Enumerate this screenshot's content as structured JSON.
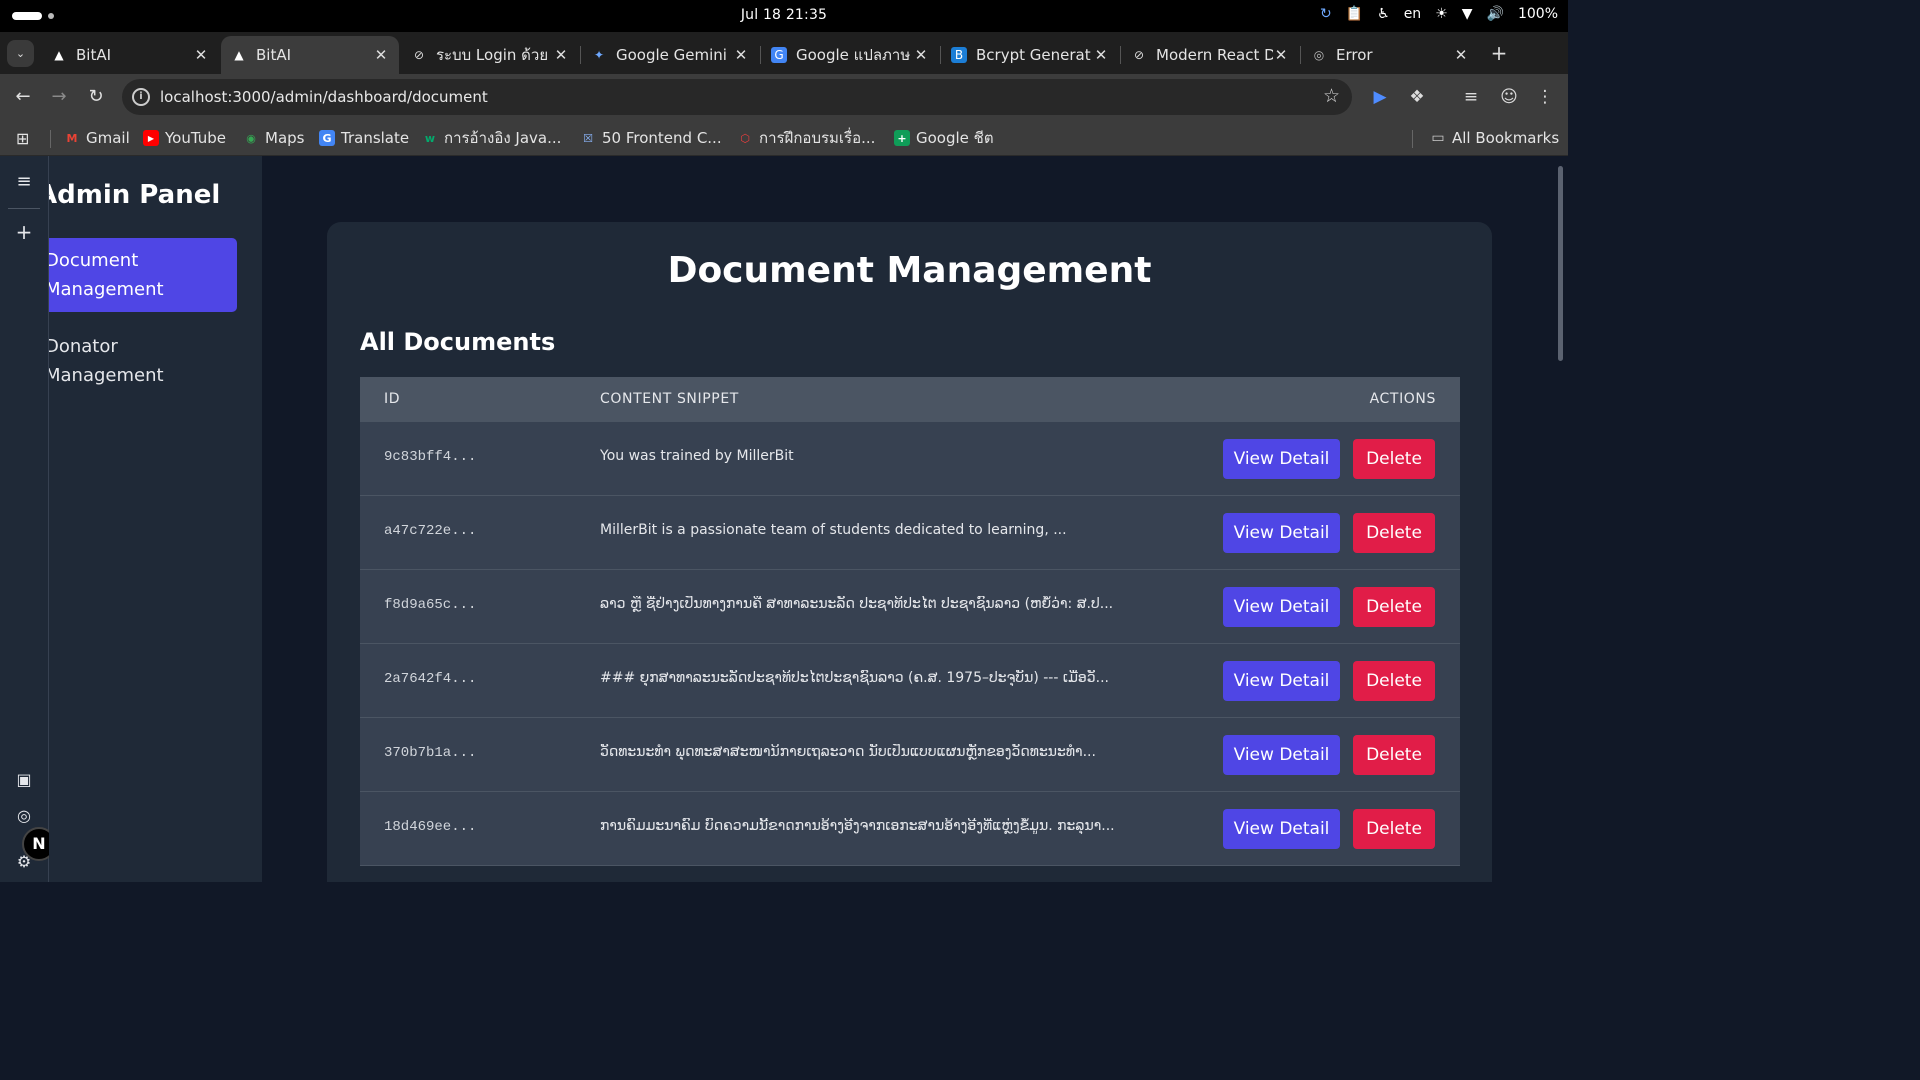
{
  "os": {
    "clock": "Jul 18  21:35",
    "language": "en",
    "battery": "100%"
  },
  "tabs": [
    {
      "title": "BitAI",
      "icon": "triangle-icon",
      "active": false
    },
    {
      "title": "BitAI",
      "icon": "triangle-icon",
      "active": true
    },
    {
      "title": "ระบบ Login ด้วย",
      "icon": "react-icon",
      "active": false
    },
    {
      "title": "Google Gemini",
      "icon": "gemini-icon",
      "active": false
    },
    {
      "title": "Google แปลภาษ",
      "icon": "translate-icon",
      "active": false
    },
    {
      "title": "Bcrypt Generat",
      "icon": "bcrypt-icon",
      "active": false
    },
    {
      "title": "Modern React D",
      "icon": "react-icon",
      "active": false
    },
    {
      "title": "Error",
      "icon": "globe-icon",
      "active": false
    }
  ],
  "address_bar": {
    "url": "localhost:3000/admin/dashboard/document"
  },
  "bookmarks": [
    {
      "label": "Gmail",
      "icon": "gmail-icon",
      "color": "#ea4335"
    },
    {
      "label": "YouTube",
      "icon": "youtube-icon",
      "color": "#ff0000"
    },
    {
      "label": "Maps",
      "icon": "maps-icon",
      "color": "#34a853"
    },
    {
      "label": "Translate",
      "icon": "translate-icon",
      "color": "#4285f4"
    },
    {
      "label": "การอ้างอิง Java...",
      "icon": "w-icon",
      "color": "#04aa6d"
    },
    {
      "label": "50 Frontend C...",
      "icon": "x-icon",
      "color": "#3b5bdb"
    },
    {
      "label": "การฝึกอบรมเรื่อ...",
      "icon": "shield-icon",
      "color": "#f03e3e"
    },
    {
      "label": "Google ชีต",
      "icon": "sheets-icon",
      "color": "#0f9d58"
    }
  ],
  "all_bookmarks_label": "All Bookmarks",
  "sidebar": {
    "title": "Admin Panel",
    "items": [
      {
        "line1": "Document",
        "line2": "Management",
        "active": true
      },
      {
        "line1": "Donator",
        "line2": "Management",
        "active": false
      }
    ]
  },
  "main": {
    "title": "Document Management",
    "section_title": "All Documents",
    "columns": {
      "id": "ID",
      "snippet": "CONTENT SNIPPET",
      "actions": "ACTIONS"
    },
    "view_label": "View Detail",
    "delete_label": "Delete",
    "rows": [
      {
        "id": "9c83bff4...",
        "snippet": "You was trained by MillerBit"
      },
      {
        "id": "a47c722e...",
        "snippet": "MillerBit is a passionate team of students dedicated to learning, ..."
      },
      {
        "id": "f8d9a65c...",
        "snippet": "ລາວ ຫຼື ຊື່ຢ່າງເປັນທາງການຄື ສາທາລະນະລັດ ປະຊາທິປະໄຕ ປະຊາຊົນລາວ (ຫຍໍ້ວ່າ: ສ.ປ..."
      },
      {
        "id": "2a7642f4...",
        "snippet": "### ຍຸກສາທາລະນະລັດປະຊາທິປະໄຕປະຊາຊົນລາວ (ຄ.ສ. 1975–ປະຈຸບັນ) --- ເມື່ອວັ..."
      },
      {
        "id": "370b7b1a...",
        "snippet": "ວັດທະນະທຳ ພຸດທະສາສະໜານິກາຍເຖລະວາດ ນັບເປັນແບບແຜນຫຼັກຂອງວັດທະນະທຳ..."
      },
      {
        "id": "18d469ee...",
        "snippet": "ການຄົມມະນາຄົມ ບົດຄວາມນີ້ຂາດການອ້າງອີງຈາກເອກະສານອ້າງອີງທີ່ແຫຼ່ງຂໍ້ມູນ. ກະລຸນາ..."
      }
    ]
  },
  "colors": {
    "accent": "#4f46e5",
    "danger": "#e11d48",
    "background": "#111827",
    "panel": "#1f2937"
  }
}
